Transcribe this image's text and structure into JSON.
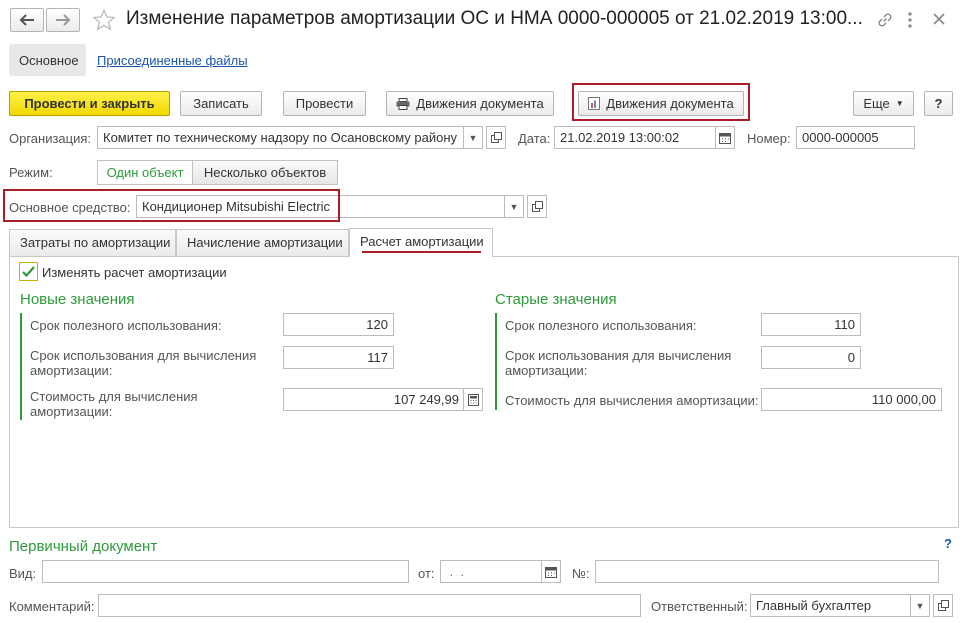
{
  "window": {
    "title": "Изменение параметров амортизации ОС и НМА 0000-000005 от 21.02.2019 13:00...",
    "icons": [
      "back-arrow-icon",
      "forward-arrow-icon",
      "star-icon",
      "link-icon",
      "more-icon",
      "close-icon"
    ]
  },
  "nav_tabs": {
    "main": "Основное",
    "files": "Присоединенные файлы"
  },
  "toolbar": {
    "post_close": "Провести и закрыть",
    "save": "Записать",
    "post": "Провести",
    "movements_print": "Движения документа",
    "movements_report": "Движения документа",
    "more": "Еще",
    "help": "?"
  },
  "header": {
    "org_label": "Организация:",
    "org_value": "Комитет по техническому надзору по Осановскому району",
    "date_label": "Дата:",
    "date_value": "21.02.2019 13:00:02",
    "number_label": "Номер:",
    "number_value": "0000-000005",
    "mode_label": "Режим:",
    "mode_single": "Один объект",
    "mode_multi": "Несколько объектов",
    "asset_label": "Основное средство:",
    "asset_value": "Кондиционер Mitsubishi Electric"
  },
  "tabs": {
    "costs": "Затраты по амортизации",
    "accrual": "Начисление амортизации",
    "calc": "Расчет амортизации"
  },
  "calc": {
    "change_checkbox": "Изменять расчет амортизации",
    "new_title": "Новые значения",
    "old_title": "Старые значения",
    "new": {
      "useful_life_label": "Срок полезного использования:",
      "useful_life_value": "120",
      "usage_term_label": "Срок использования для вычисления амортизации:",
      "usage_term_value": "117",
      "cost_label": "Стоимость для вычисления амортизации:",
      "cost_value": "107 249,99"
    },
    "old": {
      "useful_life_label": "Срок полезного использования:",
      "useful_life_value": "110",
      "usage_term_label": "Срок использования для вычисления амортизации:",
      "usage_term_value": "0",
      "cost_label": "Стоимость для вычисления амортизации:",
      "cost_value": "110 000,00"
    }
  },
  "primary_doc": {
    "title": "Первичный документ",
    "help": "?",
    "kind_label": "Вид:",
    "kind_value": "",
    "from_label": "от:",
    "from_value": " .  .",
    "number_label": "№:",
    "number_value": ""
  },
  "footer": {
    "comment_label": "Комментарий:",
    "comment_value": "",
    "responsible_label": "Ответственный:",
    "responsible_value": "Главный бухгалтер"
  },
  "colors": {
    "accent_green": "#2d9b3a",
    "primary_yellow": "#f2d900",
    "highlight_red": "#a81f26"
  }
}
